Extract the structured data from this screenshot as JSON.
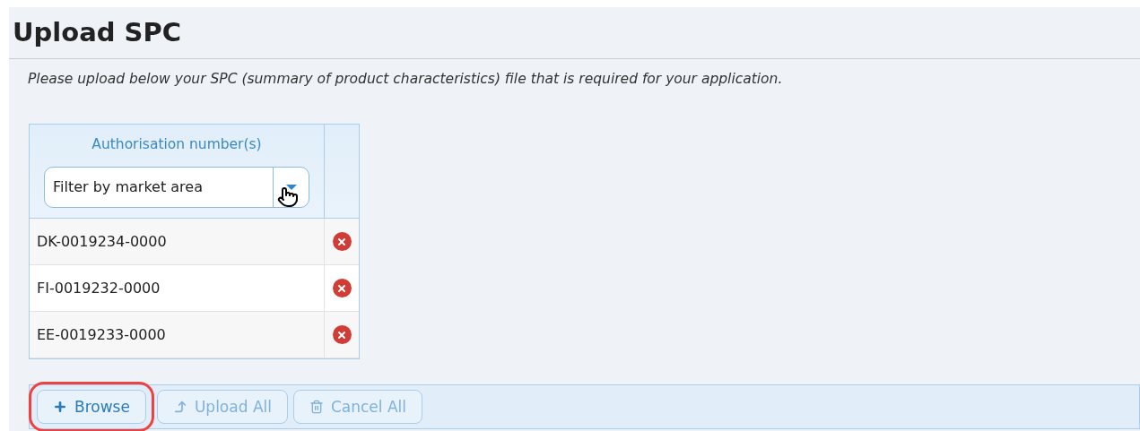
{
  "title": "Upload SPC",
  "description": "Please upload below your SPC (summary of product characteristics) file that is required for your application.",
  "table": {
    "column_header": "Authorisation number(s)",
    "filter": {
      "placeholder": "Filter by market area"
    },
    "rows": [
      {
        "number": "DK-0019234-0000"
      },
      {
        "number": "FI-0019232-0000"
      },
      {
        "number": "EE-0019233-0000"
      }
    ]
  },
  "toolbar": [
    {
      "kind": "browse",
      "label": "Browse",
      "disabled": false,
      "highlighted": true
    },
    {
      "kind": "upload",
      "label": "Upload All",
      "disabled": true,
      "highlighted": false
    },
    {
      "kind": "cancel",
      "label": "Cancel All",
      "disabled": true,
      "highlighted": false
    }
  ]
}
